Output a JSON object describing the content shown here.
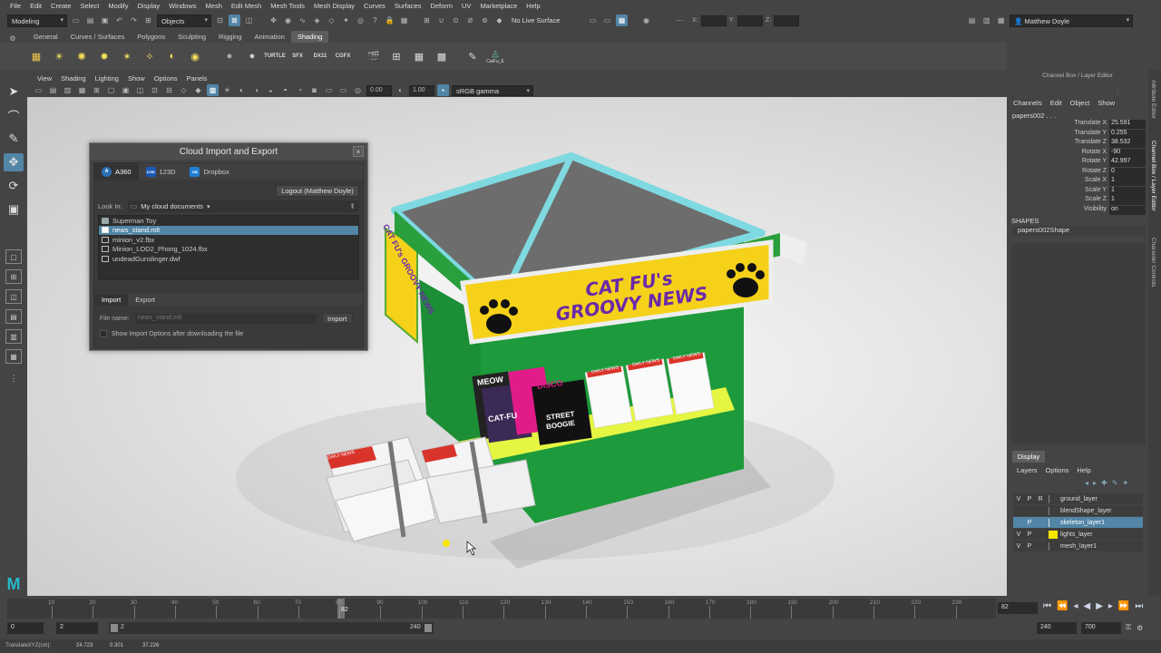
{
  "menubar": [
    "File",
    "Edit",
    "Create",
    "Select",
    "Modify",
    "Display",
    "Windows",
    "Mesh",
    "Edit Mesh",
    "Mesh Tools",
    "Mesh Display",
    "Curves",
    "Surfaces",
    "Deform",
    "UV",
    "Marketplace",
    "Help"
  ],
  "status": {
    "mode": "Modeling",
    "selection_mode": "Objects",
    "live_surface": "No Live Surface",
    "x_label": "X:",
    "y_label": "Y:",
    "z_label": "Z:",
    "user": "Matthew Doyle"
  },
  "shelf": {
    "tabs": [
      "General",
      "Curves / Surfaces",
      "Polygons",
      "Sculpting",
      "Rigging",
      "Animation",
      "Shading"
    ],
    "active_tab": "Shading",
    "labels": {
      "turtle": "TURTLE",
      "sfx": "SFX",
      "dx11": "DX11",
      "cgfx": "CGFX",
      "catfu": "CatFu_E"
    }
  },
  "panel": {
    "menus": [
      "View",
      "Shading",
      "Lighting",
      "Show",
      "Options",
      "Panels"
    ],
    "exposure": "0.00",
    "gamma": "1.00",
    "color_space": "sRGB gamma"
  },
  "dialog": {
    "title": "Cloud Import and Export",
    "close": "×",
    "tabs": [
      {
        "label": "A360",
        "logo": "A"
      },
      {
        "label": "123D",
        "logo": "123D"
      },
      {
        "label": "Dropbox",
        "logo": "DB"
      }
    ],
    "logout": "Logout (Matthew Doyle)",
    "look_in_label": "Look In:",
    "look_in_value": "My cloud documents",
    "files": [
      "Superman Toy",
      "news_stand.mlt",
      "minion_v2.fbx",
      "Minion_LOD2_Phong_1024.fbx",
      "undeadGunslinger.dwf"
    ],
    "selected_file": "news_stand.mlt",
    "sub_tabs": [
      "Import",
      "Export"
    ],
    "file_name_label": "File name:",
    "file_name_value": "news_stand.mlt",
    "import_button": "Import",
    "show_options": "Show Import Options after downloading the file"
  },
  "scene": {
    "sign_line1": "CAT FU's",
    "sign_line2": "GROOVY NEWS",
    "side_sign": "CAT FU's GROOVY NEWS",
    "daily_news": "DAILY NEWS",
    "meow": "MEOW",
    "disco": "DISCO",
    "catfu": "CAT-FU",
    "street": "STREET",
    "boogie": "BOOGIE",
    "bundle_text": "DAILY NEWS"
  },
  "channel_box": {
    "title": "Channel Box / Layer Editor",
    "menus": [
      "Channels",
      "Edit",
      "Object",
      "Show"
    ],
    "object": "papers002 . . .",
    "channels": [
      {
        "label": "Translate X",
        "value": "25.591"
      },
      {
        "label": "Translate Y",
        "value": "0.255"
      },
      {
        "label": "Translate Z",
        "value": "38.532"
      },
      {
        "label": "Rotate X",
        "value": "-90"
      },
      {
        "label": "Rotate Y",
        "value": "42.997"
      },
      {
        "label": "Rotate Z",
        "value": "0"
      },
      {
        "label": "Scale X",
        "value": "1"
      },
      {
        "label": "Scale Y",
        "value": "1"
      },
      {
        "label": "Scale Z",
        "value": "1"
      },
      {
        "label": "Visibility",
        "value": "on"
      }
    ],
    "shapes_header": "SHAPES",
    "shape": "papers002Shape"
  },
  "side_tabs": [
    "Attribute Editor",
    "Channel Box / Layer Editor",
    "Character Controls"
  ],
  "layers": {
    "display_tab": "Display",
    "menus": [
      "Layers",
      "Options",
      "Help"
    ],
    "items": [
      {
        "v": "V",
        "p": "P",
        "r": "R",
        "name": "ground_layer",
        "color": "#3d3d3d",
        "selected": false
      },
      {
        "v": "",
        "p": "",
        "r": "",
        "name": "blendShape_layer",
        "color": "#3d3d3d",
        "selected": false
      },
      {
        "v": "",
        "p": "P",
        "r": "",
        "name": "skeleton_layer1",
        "color": "#3d3d3d",
        "selected": true
      },
      {
        "v": "V",
        "p": "P",
        "r": "",
        "name": "lights_layer",
        "color": "#f5e600",
        "selected": false
      },
      {
        "v": "V",
        "p": "P",
        "r": "",
        "name": "mesh_layer1",
        "color": "#3d3d3d",
        "selected": false
      }
    ]
  },
  "timeline": {
    "ticks": [
      "10",
      "20",
      "30",
      "40",
      "50",
      "60",
      "70",
      "80",
      "90",
      "100",
      "110",
      "120",
      "130",
      "140",
      "150",
      "160",
      "170",
      "180",
      "190",
      "200",
      "210",
      "220",
      "230"
    ],
    "current_frame_marker": "82",
    "current_frame": "82",
    "range_start": "0",
    "playback_start": "2",
    "range_inner_start": "2",
    "range_inner_end": "240",
    "playback_end": "240",
    "range_end": "700"
  },
  "helpline": {
    "label": "TranslateXYZ(cm):",
    "x": "24.723",
    "y": "0.301",
    "z": "37.226"
  },
  "colors": {
    "accent": "#5285a6",
    "kiosk_green": "#1a9a3a",
    "sign_yellow": "#f5d11a",
    "sign_purple": "#6a2aa8",
    "roof_teal": "#7fd9e0"
  }
}
